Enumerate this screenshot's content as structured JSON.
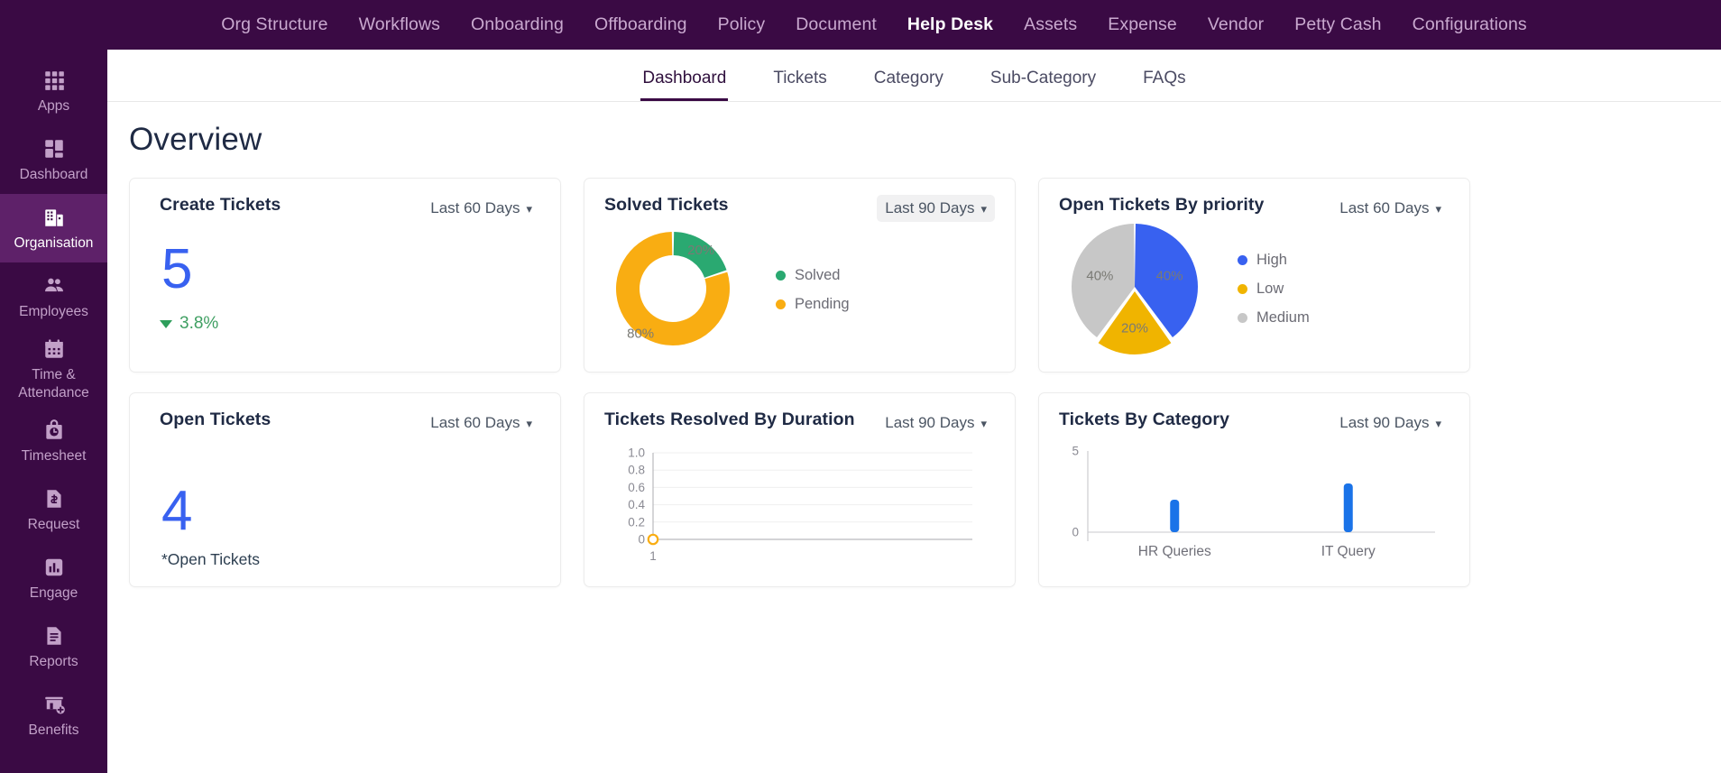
{
  "topnav": {
    "items": [
      {
        "label": "Org Structure",
        "active": false
      },
      {
        "label": "Workflows",
        "active": false
      },
      {
        "label": "Onboarding",
        "active": false
      },
      {
        "label": "Offboarding",
        "active": false
      },
      {
        "label": "Policy",
        "active": false
      },
      {
        "label": "Document",
        "active": false
      },
      {
        "label": "Help Desk",
        "active": true
      },
      {
        "label": "Assets",
        "active": false
      },
      {
        "label": "Expense",
        "active": false
      },
      {
        "label": "Vendor",
        "active": false
      },
      {
        "label": "Petty Cash",
        "active": false
      },
      {
        "label": "Configurations",
        "active": false
      }
    ]
  },
  "sidebar": {
    "items": [
      {
        "label": "Apps",
        "icon": "grid-apps-icon",
        "active": false
      },
      {
        "label": "Dashboard",
        "icon": "dashboard-tiles-icon",
        "active": false
      },
      {
        "label": "Organisation",
        "icon": "building-icon",
        "active": true
      },
      {
        "label": "Employees",
        "icon": "people-icon",
        "active": false
      },
      {
        "label": "Time & Attendance",
        "icon": "calendar-icon",
        "active": false
      },
      {
        "label": "Timesheet",
        "icon": "clock-bag-icon",
        "active": false
      },
      {
        "label": "Request",
        "icon": "money-document-icon",
        "active": false
      },
      {
        "label": "Engage",
        "icon": "bar-chart-icon",
        "active": false
      },
      {
        "label": "Reports",
        "icon": "document-lines-icon",
        "active": false
      },
      {
        "label": "Benefits",
        "icon": "store-plus-icon",
        "active": false
      }
    ]
  },
  "subnav": {
    "items": [
      {
        "label": "Dashboard",
        "active": true
      },
      {
        "label": "Tickets",
        "active": false
      },
      {
        "label": "Category",
        "active": false
      },
      {
        "label": "Sub-Category",
        "active": false
      },
      {
        "label": "FAQs",
        "active": false
      }
    ]
  },
  "page": {
    "title": "Overview"
  },
  "cards": {
    "create_tickets": {
      "title": "Create Tickets",
      "range": "Last 60 Days",
      "value": "5",
      "delta": "3.8%",
      "delta_direction": "down"
    },
    "solved_tickets": {
      "title": "Solved Tickets",
      "range": "Last 90 Days",
      "range_hover": true
    },
    "open_by_priority": {
      "title": "Open Tickets By priority",
      "range": "Last 60 Days"
    },
    "open_tickets": {
      "title": "Open Tickets",
      "range": "Last 60 Days",
      "value": "4",
      "note": "*Open Tickets"
    },
    "resolved_by_duration": {
      "title": "Tickets Resolved By Duration",
      "range": "Last 90 Days"
    },
    "tickets_by_category": {
      "title": "Tickets By Category",
      "range": "Last 90 Days"
    }
  },
  "colors": {
    "brand_purple": "#3a0a44",
    "sidebar_active": "#5e2169",
    "accent_blue": "#3861f0",
    "green": "#2aa971",
    "orange": "#f9ad12",
    "yellow": "#f0b400",
    "grey": "#c7c7c7",
    "delta_green": "#3f9f62"
  },
  "chart_data": [
    {
      "id": "solved-tickets-donut",
      "type": "pie",
      "title": "Solved Tickets",
      "donut": true,
      "labels": [
        "Solved",
        "Pending"
      ],
      "values": [
        20,
        80
      ],
      "value_labels": [
        "20%",
        "80%"
      ],
      "colors": [
        "#2aa971",
        "#f9ad12"
      ],
      "legend": "right"
    },
    {
      "id": "open-tickets-by-priority-pie",
      "type": "pie",
      "title": "Open Tickets By priority",
      "donut": false,
      "labels": [
        "High",
        "Low",
        "Medium"
      ],
      "values": [
        40,
        20,
        40
      ],
      "value_labels": [
        "40%",
        "20%",
        "40%"
      ],
      "colors": [
        "#3861f0",
        "#f0b400",
        "#c7c7c7"
      ],
      "legend": "right"
    },
    {
      "id": "tickets-resolved-by-duration-line",
      "type": "line",
      "title": "Tickets Resolved By Duration",
      "x": [
        1
      ],
      "xticklabels": [
        "1"
      ],
      "values": [
        0
      ],
      "ylim": [
        0,
        1.0
      ],
      "yticklabels": [
        "0",
        "0.2",
        "0.4",
        "0.6",
        "0.8",
        "1.0"
      ],
      "yticks": [
        0,
        0.2,
        0.4,
        0.6,
        0.8,
        1.0
      ],
      "grid": true,
      "marker_color": "#f9ad12",
      "xlabel": "",
      "ylabel": ""
    },
    {
      "id": "tickets-by-category-bar",
      "type": "bar",
      "title": "Tickets By Category",
      "categories": [
        "HR Queries",
        "IT Query"
      ],
      "values": [
        2,
        3
      ],
      "ylim": [
        0,
        5
      ],
      "yticklabels": [
        "0",
        "5"
      ],
      "bar_color": "#1a73e8",
      "grid": false,
      "xlabel": "",
      "ylabel": ""
    }
  ]
}
